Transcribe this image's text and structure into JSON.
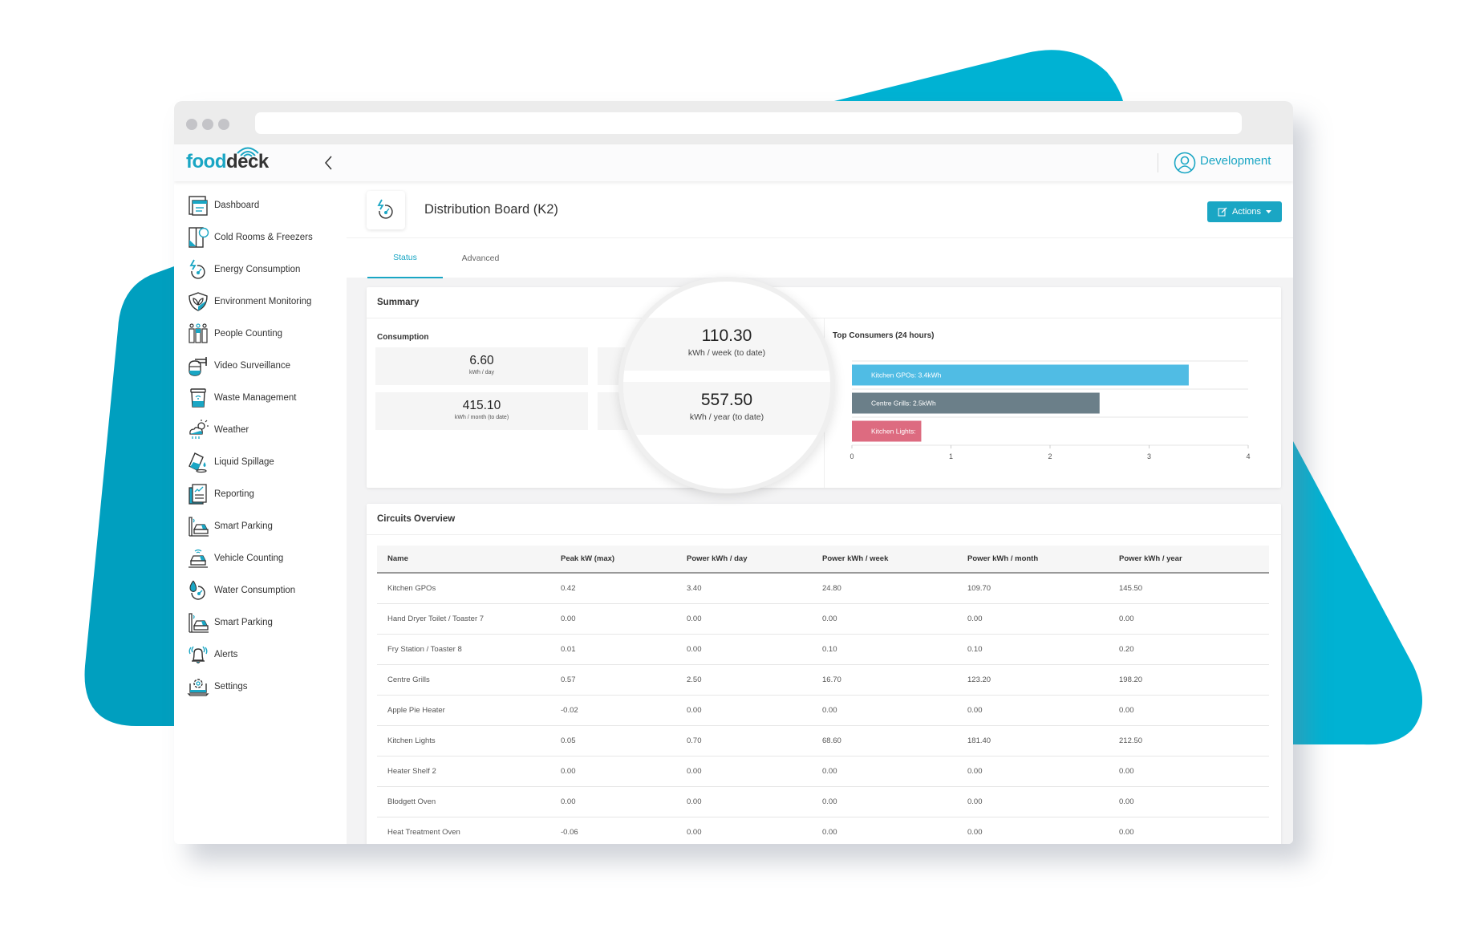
{
  "colors": {
    "brand": "#1aa6c4",
    "blob_light": "#00b2d3",
    "blob_dark": "#009fbf",
    "bar_gpos": "#50bce4",
    "bar_grills": "#6b7f89",
    "bar_lights": "#dd6b80"
  },
  "header": {
    "logo_food": "food",
    "logo_deck": "deck",
    "user_label": "Development"
  },
  "sidebar": {
    "items": [
      {
        "label": "Dashboard",
        "icon": "dashboard-icon"
      },
      {
        "label": "Cold Rooms & Freezers",
        "icon": "fridge-icon"
      },
      {
        "label": "Energy Consumption",
        "icon": "energy-icon"
      },
      {
        "label": "Environment Monitoring",
        "icon": "shield-leaf-icon"
      },
      {
        "label": "People Counting",
        "icon": "people-icon"
      },
      {
        "label": "Video Surveillance",
        "icon": "camera-icon"
      },
      {
        "label": "Waste Management",
        "icon": "bin-icon"
      },
      {
        "label": "Weather",
        "icon": "weather-icon"
      },
      {
        "label": "Liquid Spillage",
        "icon": "spill-icon"
      },
      {
        "label": "Reporting",
        "icon": "report-icon"
      },
      {
        "label": "Smart Parking",
        "icon": "parking-icon"
      },
      {
        "label": "Vehicle Counting",
        "icon": "car-icon"
      },
      {
        "label": "Water Consumption",
        "icon": "water-icon"
      },
      {
        "label": "Smart Parking",
        "icon": "parking-icon"
      },
      {
        "label": "Alerts",
        "icon": "bell-icon"
      },
      {
        "label": "Settings",
        "icon": "settings-icon"
      }
    ]
  },
  "page": {
    "title": "Distribution Board (K2)",
    "actions_label": "Actions",
    "tabs": [
      {
        "label": "Status",
        "active": true
      },
      {
        "label": "Advanced",
        "active": false
      }
    ]
  },
  "summary": {
    "title": "Summary",
    "consumption_label": "Consumption",
    "stats": [
      {
        "value": "6.60",
        "unit": "kWh / day"
      },
      {
        "value": "110.30",
        "unit": "kWh / week (to date)"
      },
      {
        "value": "415.10",
        "unit": "kWh / month (to date)"
      },
      {
        "value": "557.50",
        "unit": "kWh / year (to date)"
      }
    ]
  },
  "chart_data": {
    "type": "bar",
    "orientation": "horizontal",
    "title": "Top Consumers (24 hours)",
    "categories": [
      "Kitchen GPOs",
      "Centre Grills",
      "Kitchen Lights"
    ],
    "values": [
      3.4,
      2.5,
      0.7
    ],
    "bar_labels": [
      "Kitchen GPOs: 3.4kWh",
      "Centre Grills: 2.5kWh",
      "Kitchen Lights:"
    ],
    "xlim": [
      0,
      4
    ],
    "xticks": [
      "0",
      "1",
      "2",
      "3",
      "4"
    ],
    "xlabel": "",
    "ylabel": "",
    "grid": true,
    "legend": "none"
  },
  "circuits": {
    "title": "Circuits Overview",
    "columns": [
      "Name",
      "Peak kW (max)",
      "Power kWh / day",
      "Power kWh / week",
      "Power kWh / month",
      "Power kWh / year"
    ],
    "rows": [
      [
        "Kitchen GPOs",
        "0.42",
        "3.40",
        "24.80",
        "109.70",
        "145.50"
      ],
      [
        "Hand Dryer Toilet / Toaster 7",
        "0.00",
        "0.00",
        "0.00",
        "0.00",
        "0.00"
      ],
      [
        "Fry Station / Toaster 8",
        "0.01",
        "0.00",
        "0.10",
        "0.10",
        "0.20"
      ],
      [
        "Centre Grills",
        "0.57",
        "2.50",
        "16.70",
        "123.20",
        "198.20"
      ],
      [
        "Apple Pie Heater",
        "-0.02",
        "0.00",
        "0.00",
        "0.00",
        "0.00"
      ],
      [
        "Kitchen Lights",
        "0.05",
        "0.70",
        "68.60",
        "181.40",
        "212.50"
      ],
      [
        "Heater Shelf 2",
        "0.00",
        "0.00",
        "0.00",
        "0.00",
        "0.00"
      ],
      [
        "Blodgett Oven",
        "0.00",
        "0.00",
        "0.00",
        "0.00",
        "0.00"
      ],
      [
        "Heat Treatment Oven",
        "-0.06",
        "0.00",
        "0.00",
        "0.00",
        "0.00"
      ]
    ]
  }
}
